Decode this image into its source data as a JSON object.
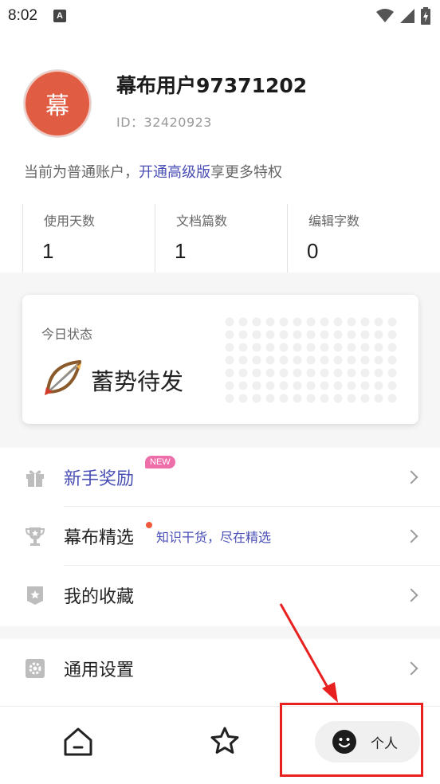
{
  "status_bar": {
    "time": "8:02",
    "notification_icon": "a-icon",
    "icons": [
      "wifi-icon",
      "signal-icon",
      "battery-charging-icon"
    ]
  },
  "profile": {
    "avatar_char": "幕",
    "username": "幕布用户97371202",
    "id_text": "ID：32420923"
  },
  "account": {
    "prefix": "当前为普通账户，",
    "link": "开通高级版",
    "suffix": "享更多特权"
  },
  "stats": [
    {
      "label": "使用天数",
      "value": "1"
    },
    {
      "label": "文档篇数",
      "value": "1"
    },
    {
      "label": "编辑字数",
      "value": "0"
    }
  ],
  "today": {
    "label": "今日状态",
    "status": "蓄势待发",
    "icon": "bow-arrow-icon"
  },
  "menu": {
    "items": [
      {
        "label": "新手奖励",
        "icon": "gift-icon",
        "badge": "NEW"
      },
      {
        "label": "幕布精选",
        "icon": "trophy-icon",
        "sub": "知识干货，尽在精选"
      },
      {
        "label": "我的收藏",
        "icon": "bookmark-star-icon"
      },
      {
        "label": "通用设置",
        "icon": "gear-icon"
      }
    ]
  },
  "bottom_nav": {
    "home_icon": "home-icon",
    "star_icon": "star-icon",
    "me_label": "个人",
    "me_icon": "smiley-icon"
  },
  "colors": {
    "accent": "#4a4fb5",
    "avatar": "#e05c43",
    "badge": "#ee6ea9",
    "annotation": "#e82020"
  }
}
